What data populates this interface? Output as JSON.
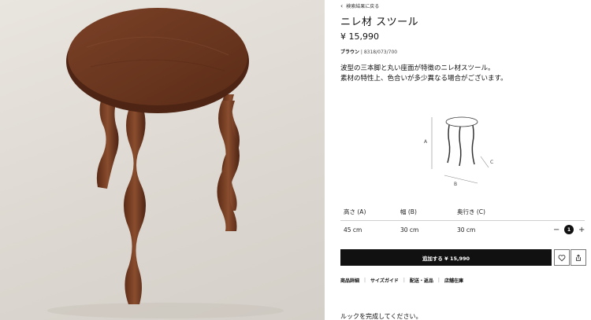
{
  "back_link": "検索結果に戻る",
  "product": {
    "title": "ニレ材 スツール",
    "price": "¥ 15,990",
    "color_name": "ブラウン",
    "ref_sep": " | ",
    "reference": "8318/073/700",
    "description": [
      "波型の三本脚と丸い座面が特徴のニレ材スツール。",
      "素材の特性上、色合いが多少異なる場合がございます。"
    ]
  },
  "diagram": {
    "label_a": "A",
    "label_b": "B",
    "label_c": "C"
  },
  "dimensions": {
    "headers": [
      "高さ (A)",
      "幅 (B)",
      "奥行き (C)"
    ],
    "values": [
      "45 cm",
      "30 cm",
      "30 cm"
    ]
  },
  "quantity": {
    "value": "1",
    "minus": "−",
    "plus": "+"
  },
  "add_to_cart": "追加する ¥ 15,990",
  "links": [
    "商品詳細",
    "サイズガイド",
    "配送・返品",
    "店舗在庫"
  ],
  "links_sep": "|",
  "complete_look": "ルックを完成してください。",
  "colors": {
    "wood": "#6e3a22",
    "wood_dark": "#4e2414",
    "background": "#e3dfd9",
    "button": "#111111"
  }
}
